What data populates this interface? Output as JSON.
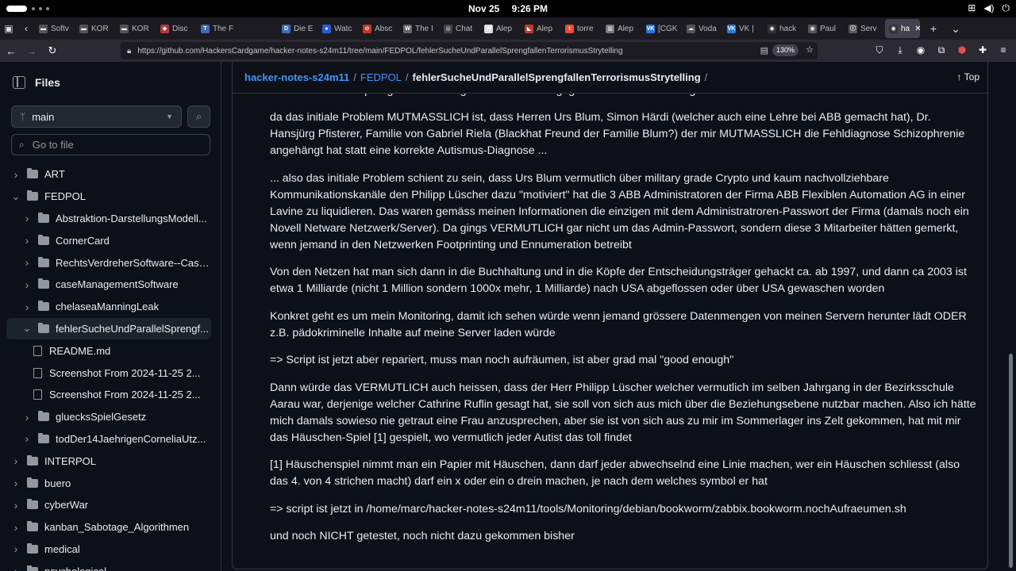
{
  "os": {
    "date": "Nov 25",
    "time": "9:26 PM",
    "tray_icons": [
      "network-icon",
      "volume-icon",
      "power-icon"
    ]
  },
  "tabs": [
    {
      "label": "Softv",
      "fav_color": "#555555",
      "fav": "▬"
    },
    {
      "label": "KOR",
      "fav_color": "#555555",
      "fav": "▬"
    },
    {
      "label": "KOR",
      "fav_color": "#555555",
      "fav": "▬"
    },
    {
      "label": "Disc",
      "fav_color": "#b33a3a",
      "fav": "◆"
    },
    {
      "label": "The F",
      "fav_color": "#3b6db5",
      "fav": "T"
    },
    {
      "label": "",
      "fav_color": "#1c1b22",
      "fav": ""
    },
    {
      "label": "Die E",
      "fav_color": "#3b6db5",
      "fav": "D"
    },
    {
      "label": "Watc",
      "fav_color": "#2a5bd7",
      "fav": "●"
    },
    {
      "label": "Absc",
      "fav_color": "#c0392b",
      "fav": "⊘"
    },
    {
      "label": "The I",
      "fav_color": "#666666",
      "fav": "W"
    },
    {
      "label": "Chat",
      "fav_color": "#444444",
      "fav": "◎"
    },
    {
      "label": "Alep",
      "fav_color": "#dddddd",
      "fav": "W"
    },
    {
      "label": "Alep",
      "fav_color": "#c0392b",
      "fav": "◣"
    },
    {
      "label": "torre",
      "fav_color": "#e74c3c",
      "fav": "t"
    },
    {
      "label": "Alep",
      "fav_color": "#777777",
      "fav": "▥"
    },
    {
      "label": "[CGK",
      "fav_color": "#2b7bd9",
      "fav": "VK"
    },
    {
      "label": "Voda",
      "fav_color": "#555555",
      "fav": "☁"
    },
    {
      "label": "VK |",
      "fav_color": "#2b7bd9",
      "fav": "VK"
    },
    {
      "label": "hack",
      "fav_color": "#333333",
      "fav": "◉"
    },
    {
      "label": "Paul",
      "fav_color": "#555555",
      "fav": "◉"
    },
    {
      "label": "Serv",
      "fav_color": "#555555",
      "fav": "ⓘ"
    },
    {
      "label": "ha",
      "fav_color": "#333333",
      "fav": "◉",
      "active": true
    }
  ],
  "nav": {
    "url": "https://github.com/HackersCardgame/hacker-notes-s24m11/tree/main/FEDPOL/fehlerSucheUndParallelSprengfallenTerrorismusStrytelling",
    "zoom": "130%"
  },
  "sidebar": {
    "title": "Files",
    "branch": "main",
    "goto_placeholder": "Go to file",
    "tree": [
      {
        "label": "ART",
        "type": "folder",
        "level": 0,
        "expanded": false
      },
      {
        "label": "FEDPOL",
        "type": "folder",
        "level": 0,
        "expanded": true
      },
      {
        "label": "Abstraktion-DarstellungsModell...",
        "type": "folder",
        "level": 1,
        "expanded": false
      },
      {
        "label": "CornerCard",
        "type": "folder",
        "level": 1,
        "expanded": false
      },
      {
        "label": "RechtsVerdreherSoftware--Case...",
        "type": "folder",
        "level": 1,
        "expanded": false
      },
      {
        "label": "caseManagementSoftware",
        "type": "folder",
        "level": 1,
        "expanded": false
      },
      {
        "label": "chelaseaManningLeak",
        "type": "folder",
        "level": 1,
        "expanded": false
      },
      {
        "label": "fehlerSucheUndParallelSprengf...",
        "type": "folder",
        "level": 1,
        "expanded": true,
        "selected": true
      },
      {
        "label": "README.md",
        "type": "file",
        "level": 2
      },
      {
        "label": "Screenshot From 2024-11-25 2...",
        "type": "file",
        "level": 2
      },
      {
        "label": "Screenshot From 2024-11-25 2...",
        "type": "file",
        "level": 2
      },
      {
        "label": "gluecksSpielGesetz",
        "type": "folder",
        "level": 1,
        "expanded": false
      },
      {
        "label": "todDer14JaehrigenCorneliaUtz...",
        "type": "folder",
        "level": 1,
        "expanded": false
      },
      {
        "label": "INTERPOL",
        "type": "folder",
        "level": 0,
        "expanded": false
      },
      {
        "label": "buero",
        "type": "folder",
        "level": 0,
        "expanded": false
      },
      {
        "label": "cyberWar",
        "type": "folder",
        "level": 0,
        "expanded": false
      },
      {
        "label": "kanban_Sabotage_Algorithmen",
        "type": "folder",
        "level": 0,
        "expanded": false
      },
      {
        "label": "medical",
        "type": "folder",
        "level": 0,
        "expanded": false
      },
      {
        "label": "psychological",
        "type": "folder",
        "level": 0,
        "expanded": false
      }
    ]
  },
  "breadcrumb": {
    "repo": "hacker-notes-s24m11",
    "folder": "FEDPOL",
    "current": "fehlerSucheUndParallelSprengfallenTerrorismusStrytelling",
    "top_label": "Top"
  },
  "readme": {
    "paragraphs": [
      "dann hieben den Sprengfallen Drohungen wird auch z.B. gegen meine Geschwister geführt",
      "da das initiale Problem MUTMASSLICH ist, dass Herren Urs Blum, Simon Härdi (welcher auch eine Lehre bei ABB gemacht hat), Dr. Hansjürg Pfisterer, Familie von Gabriel Riela (Blackhat Freund der Familie Blum?) der mir MUTMASSLICH die Fehldiagnose Schizophrenie angehängt hat statt eine korrekte Autismus-Diagnose ...",
      "... also das initiale Problem schient zu sein, dass Urs Blum vermutlich über military grade Crypto und kaum nachvollziehbare Kommunikationskanäle den Philipp Lüscher dazu \"motiviert\" hat die 3 ABB Administratoren der Firma ABB Flexiblen Automation AG in einer Lavine zu liquidieren. Das waren gemäss meinen Informationen die einzigen mit dem Administratroren-Passwort der Firma (damals noch ein Novell Netware Netzwerk/Server). Da gings VERMUTLICH gar nicht um das Admin-Passwort, sondern diese 3 Mitarbeiter hätten gemerkt, wenn jemand in den Netzwerken Footprinting und Ennumeration betreibt",
      "Von den Netzen hat man sich dann in die Buchhaltung und in die Köpfe der Entscheidungsträger gehackt ca. ab 1997, und dann ca 2003 ist etwa 1 Milliarde (nicht 1 Million sondern 1000x mehr, 1 Milliarde) nach USA abgeflossen oder über USA gewaschen worden",
      "Konkret geht es um mein Monitoring, damit ich sehen würde wenn jemand grössere Datenmengen von meinen Servern herunter lädt ODER z.B. pädokriminelle Inhalte auf meine Server laden würde",
      "=> Script ist jetzt aber repariert, muss man noch aufräumen, ist aber grad mal \"good enough\"",
      "Dann würde das VERMUTLICH auch heissen, dass der Herr Philipp Lüscher welcher vermutlich im selben Jahrgang in der Bezirksschule Aarau war, derjenige welcher Cathrine Ruflin gesagt hat, sie soll von sich aus mich über die Beziehungsebene nutzbar machen. Also ich hätte mich damals sowieso nie getraut eine Frau anzusprechen, aber sie ist von sich aus zu mir im Sommerlager ins Zelt gekommen, hat mit mir das Häuschen-Spiel [1] gespielt, wo vermutlich jeder Autist das toll findet",
      "[1] Häuschenspiel nimmt man ein Papier mit Häuschen, dann darf jeder abwechselnd eine Linie machen, wer ein Häuschen schliesst (also das 4. von 4 strichen macht) darf ein x oder ein o drein machen, je nach dem welches symbol er hat",
      "=> script ist jetzt in /home/marc/hacker-notes-s24m11/tools/Monitoring/debian/bookworm/zabbix.bookworm.nochAufraeumen.sh",
      "und noch NICHT getestet, noch nicht dazu gekommen bisher"
    ]
  }
}
